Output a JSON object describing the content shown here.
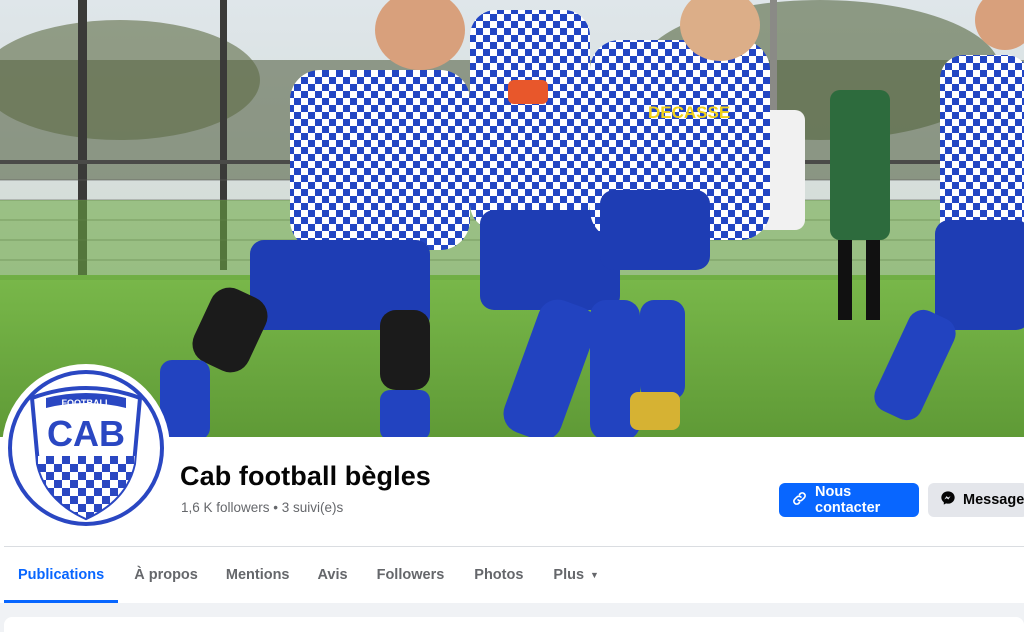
{
  "page": {
    "name": "Cab football bègles",
    "stats": "1,6 K followers • 3 suivi(e)s"
  },
  "avatar": {
    "crest_top_text": "FOOTBALL",
    "crest_main_text": "CAB"
  },
  "cover": {
    "shirt_sponsor": "DECASSE"
  },
  "actions": {
    "contact_label": "Nous contacter",
    "message_label": "Message",
    "contact_icon": "link-icon",
    "message_icon": "messenger-icon"
  },
  "tabs": [
    {
      "label": "Publications",
      "active": true
    },
    {
      "label": "À propos",
      "active": false
    },
    {
      "label": "Mentions",
      "active": false
    },
    {
      "label": "Avis",
      "active": false
    },
    {
      "label": "Followers",
      "active": false
    },
    {
      "label": "Photos",
      "active": false
    },
    {
      "label": "Plus",
      "active": false,
      "dropdown": true
    }
  ],
  "colors": {
    "accent": "#0866ff",
    "text_primary": "#050505",
    "text_secondary": "#65676b",
    "secondary_button": "#e4e6eb",
    "jersey_blue": "#1f3fb8"
  }
}
